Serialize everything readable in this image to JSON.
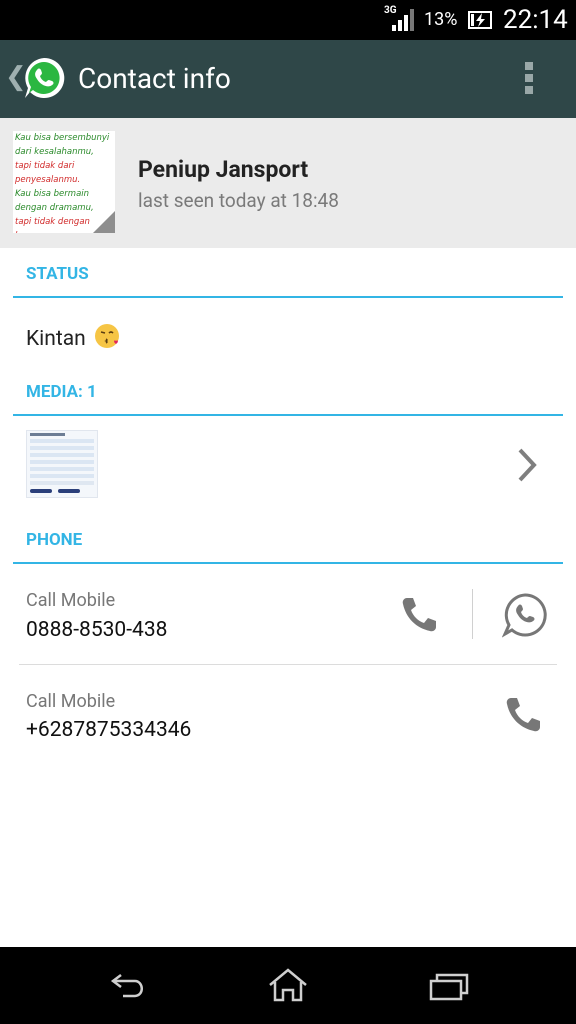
{
  "status_bar": {
    "network": "3G",
    "battery_percent": "13%",
    "time": "22:14"
  },
  "app_bar": {
    "title": "Contact info",
    "back_icon": "chevron-left-icon",
    "logo_icon": "whatsapp-logo-icon",
    "menu_icon": "overflow-menu-icon",
    "color": "#2f4748"
  },
  "profile": {
    "name": "Peniup Jansport",
    "last_seen": "last seen today at 18:48",
    "avatar_lines": [
      {
        "text": "Kau bisa bersembunyi",
        "color": "#2a8a2a"
      },
      {
        "text": "dari kesalahanmu,",
        "color": "#2a8a2a"
      },
      {
        "text": "tapi tidak dari",
        "color": "#d12a2a"
      },
      {
        "text": "penyesalanmu.",
        "color": "#d12a2a"
      },
      {
        "text": "Kau bisa bermain",
        "color": "#2a8a2a"
      },
      {
        "text": "dengan dramamu,",
        "color": "#2a8a2a"
      },
      {
        "text": "tapi tidak dengan",
        "color": "#d12a2a"
      },
      {
        "text": "karmamu.",
        "color": "#d12a2a"
      }
    ]
  },
  "status_section": {
    "header": "STATUS",
    "text": "Kintan",
    "emoji_icon": "kissing-face-emoji-icon"
  },
  "media_section": {
    "header": "MEDIA: 1",
    "chevron_icon": "chevron-right-icon"
  },
  "phone_section": {
    "header": "PHONE",
    "entries": [
      {
        "label": "Call Mobile",
        "number": "0888-8530-438"
      },
      {
        "label": "Call Mobile",
        "number": "+6287875334346"
      }
    ]
  },
  "accent_color": "#33b5e5",
  "nav_bar": {
    "icons": [
      "back-icon",
      "home-icon",
      "recent-apps-icon"
    ]
  }
}
